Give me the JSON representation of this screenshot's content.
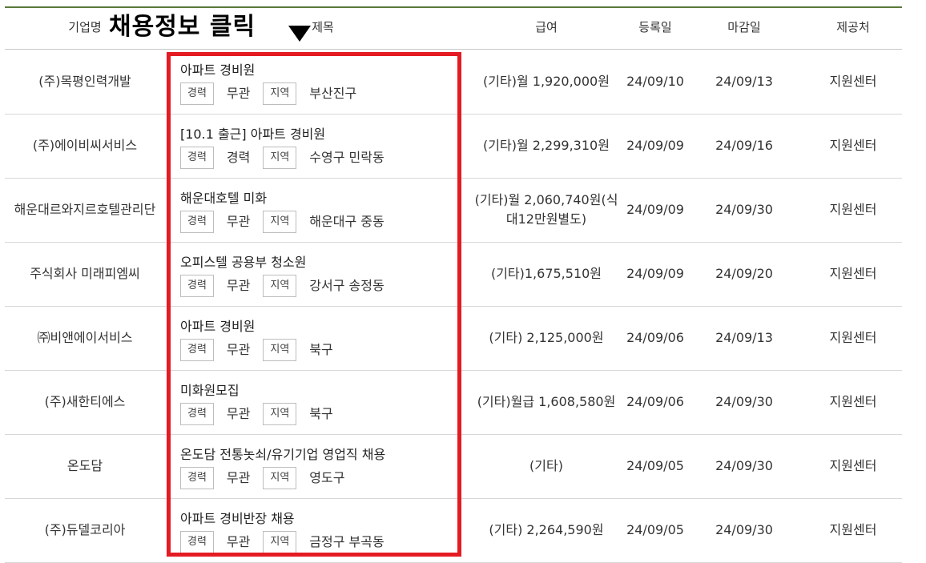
{
  "annotation": {
    "text": "채용정보 클릭"
  },
  "columns": {
    "company": "기업명",
    "title": "제목",
    "salary": "급여",
    "registered": "등록일",
    "deadline": "마감일",
    "source": "제공처"
  },
  "colors": {
    "header_border": "#5a7a3a",
    "highlight": "#e41b23"
  },
  "rows": [
    {
      "company": "(주)목평인력개발",
      "title": "아파트 경비원",
      "tag1": "경력",
      "tag1_value": "무관",
      "tag2": "지역",
      "tag2_value": "부산진구",
      "salary": "(기타)월 1,920,000원",
      "registered": "24/09/10",
      "deadline": "24/09/13",
      "source": "지원센터"
    },
    {
      "company": "(주)에이비씨서비스",
      "title": "[10.1 출근] 아파트 경비원",
      "tag1": "경력",
      "tag1_value": "경력",
      "tag2": "지역",
      "tag2_value": "수영구 민락동",
      "salary": "(기타)월 2,299,310원",
      "registered": "24/09/09",
      "deadline": "24/09/16",
      "source": "지원센터"
    },
    {
      "company": "해운대르와지르호텔관리단",
      "title": "해운대호텔 미화",
      "tag1": "경력",
      "tag1_value": "무관",
      "tag2": "지역",
      "tag2_value": "해운대구 중동",
      "salary": "(기타)월 2,060,740원(식대12만원별도)",
      "registered": "24/09/09",
      "deadline": "24/09/30",
      "source": "지원센터"
    },
    {
      "company": "주식회사 미래피엠씨",
      "title": "오피스텔 공용부 청소원",
      "tag1": "경력",
      "tag1_value": "무관",
      "tag2": "지역",
      "tag2_value": "강서구 송정동",
      "salary": "(기타)1,675,510원",
      "registered": "24/09/09",
      "deadline": "24/09/20",
      "source": "지원센터"
    },
    {
      "company": "㈜비앤에이서비스",
      "title": "아파트 경비원",
      "tag1": "경력",
      "tag1_value": "무관",
      "tag2": "지역",
      "tag2_value": "북구",
      "salary": "(기타) 2,125,000원",
      "registered": "24/09/06",
      "deadline": "24/09/13",
      "source": "지원센터"
    },
    {
      "company": "(주)새한티에스",
      "title": "미화원모집",
      "tag1": "경력",
      "tag1_value": "무관",
      "tag2": "지역",
      "tag2_value": "북구",
      "salary": "(기타)월급 1,608,580원",
      "registered": "24/09/06",
      "deadline": "24/09/30",
      "source": "지원센터"
    },
    {
      "company": "온도담",
      "title": "온도담 전통놋쇠/유기기업 영업직 채용",
      "tag1": "경력",
      "tag1_value": "무관",
      "tag2": "지역",
      "tag2_value": "영도구",
      "salary": "(기타)",
      "registered": "24/09/05",
      "deadline": "24/09/30",
      "source": "지원센터"
    },
    {
      "company": "(주)듀델코리아",
      "title": "아파트 경비반장 채용",
      "tag1": "경력",
      "tag1_value": "무관",
      "tag2": "지역",
      "tag2_value": "금정구 부곡동",
      "salary": "(기타) 2,264,590원",
      "registered": "24/09/05",
      "deadline": "24/09/30",
      "source": "지원센터"
    }
  ]
}
